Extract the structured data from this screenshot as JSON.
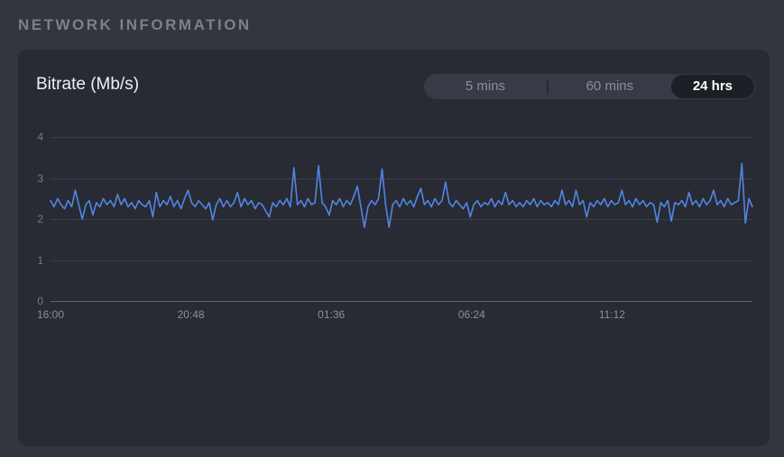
{
  "page": {
    "header": "NETWORK INFORMATION"
  },
  "card": {
    "title": "Bitrate (Mb/s)"
  },
  "range_selector": {
    "options": [
      {
        "label": "5 mins",
        "selected": false
      },
      {
        "label": "60 mins",
        "selected": false
      },
      {
        "label": "24 hrs",
        "selected": true
      }
    ]
  },
  "colors": {
    "page_bg": "#33363f",
    "card_bg": "#282b33",
    "line": "#5285e4",
    "selected_pill_bg": "#1c1f26",
    "selected_pill_text": "#ffffff",
    "inactive_text": "#8b8f99"
  },
  "chart_data": {
    "type": "line",
    "title": "Bitrate (Mb/s)",
    "xlabel": "",
    "ylabel": "",
    "ylim": [
      0,
      4
    ],
    "yticks": [
      0,
      1,
      2,
      3,
      4
    ],
    "xticks": [
      {
        "label": "16:00",
        "pos": 0.0
      },
      {
        "label": "20:48",
        "pos": 0.2
      },
      {
        "label": "01:36",
        "pos": 0.4
      },
      {
        "label": "06:24",
        "pos": 0.6
      },
      {
        "label": "11:12",
        "pos": 0.8
      }
    ],
    "x_range_hours": 24,
    "grid": "horizontal-only",
    "legend": "none",
    "series": [
      {
        "name": "bitrate_mbps",
        "values": [
          2.45,
          2.3,
          2.5,
          2.35,
          2.25,
          2.45,
          2.3,
          2.7,
          2.35,
          2.0,
          2.35,
          2.45,
          2.1,
          2.4,
          2.3,
          2.5,
          2.35,
          2.45,
          2.3,
          2.6,
          2.35,
          2.5,
          2.3,
          2.4,
          2.25,
          2.45,
          2.35,
          2.3,
          2.45,
          2.05,
          2.65,
          2.3,
          2.45,
          2.35,
          2.55,
          2.3,
          2.45,
          2.25,
          2.5,
          2.7,
          2.4,
          2.3,
          2.45,
          2.35,
          2.25,
          2.4,
          1.98,
          2.35,
          2.5,
          2.3,
          2.45,
          2.3,
          2.4,
          2.65,
          2.3,
          2.5,
          2.35,
          2.45,
          2.25,
          2.4,
          2.35,
          2.2,
          2.05,
          2.4,
          2.3,
          2.45,
          2.35,
          2.5,
          2.3,
          3.25,
          2.35,
          2.45,
          2.3,
          2.5,
          2.35,
          2.4,
          3.3,
          2.4,
          2.3,
          2.1,
          2.45,
          2.35,
          2.5,
          2.3,
          2.45,
          2.35,
          2.55,
          2.8,
          2.3,
          1.8,
          2.3,
          2.45,
          2.35,
          2.5,
          3.22,
          2.35,
          1.8,
          2.35,
          2.45,
          2.3,
          2.5,
          2.35,
          2.45,
          2.3,
          2.55,
          2.75,
          2.35,
          2.45,
          2.3,
          2.5,
          2.35,
          2.45,
          2.9,
          2.4,
          2.3,
          2.45,
          2.35,
          2.25,
          2.4,
          2.05,
          2.35,
          2.45,
          2.3,
          2.4,
          2.35,
          2.5,
          2.3,
          2.45,
          2.35,
          2.65,
          2.35,
          2.45,
          2.3,
          2.4,
          2.3,
          2.45,
          2.35,
          2.5,
          2.3,
          2.45,
          2.35,
          2.4,
          2.3,
          2.45,
          2.35,
          2.7,
          2.35,
          2.45,
          2.3,
          2.7,
          2.35,
          2.45,
          2.05,
          2.4,
          2.3,
          2.45,
          2.35,
          2.5,
          2.3,
          2.45,
          2.35,
          2.4,
          2.7,
          2.35,
          2.45,
          2.3,
          2.5,
          2.35,
          2.45,
          2.3,
          2.4,
          2.35,
          1.92,
          2.4,
          2.3,
          2.45,
          1.95,
          2.4,
          2.35,
          2.45,
          2.3,
          2.65,
          2.35,
          2.45,
          2.3,
          2.5,
          2.35,
          2.45,
          2.7,
          2.35,
          2.45,
          2.3,
          2.5,
          2.35,
          2.4,
          2.45,
          3.35,
          1.9,
          2.5,
          2.3
        ]
      }
    ]
  }
}
